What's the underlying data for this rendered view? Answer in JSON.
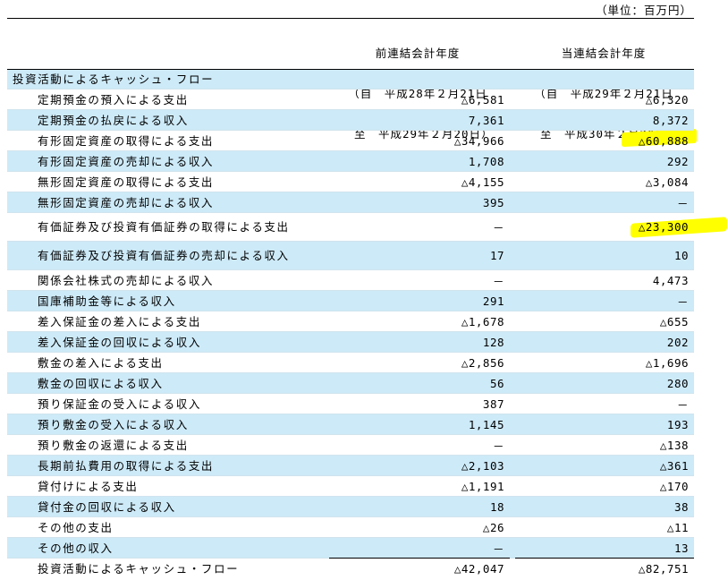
{
  "unit_label": "（単位：百万円）",
  "header": {
    "prev": [
      "前連結会計年度",
      "（自　平成28年２月21日",
      "　至　平成29年２月20日）"
    ],
    "curr": [
      "当連結会計年度",
      "（自　平成29年２月21日",
      "　至　平成30年２月20日）"
    ]
  },
  "section_title": "投資活動によるキャッシュ・フロー",
  "rows": [
    {
      "label": "定期預金の預入による支出",
      "prev": "△6,581",
      "curr": "△6,320"
    },
    {
      "label": "定期預金の払戻による収入",
      "prev": "7,361",
      "curr": "8,372"
    },
    {
      "label": "有形固定資産の取得による支出",
      "prev": "△34,966",
      "curr": "△60,888"
    },
    {
      "label": "有形固定資産の売却による収入",
      "prev": "1,708",
      "curr": "292"
    },
    {
      "label": "無形固定資産の取得による支出",
      "prev": "△4,155",
      "curr": "△3,084"
    },
    {
      "label": "無形固定資産の売却による収入",
      "prev": "395",
      "curr": "－"
    },
    {
      "label": "有価証券及び投資有価証券の取得による支出",
      "prev": "－",
      "curr": "△23,300"
    },
    {
      "label": "有価証券及び投資有価証券の売却による収入",
      "prev": "17",
      "curr": "10"
    },
    {
      "label": "関係会社株式の売却による収入",
      "prev": "－",
      "curr": "4,473"
    },
    {
      "label": "国庫補助金等による収入",
      "prev": "291",
      "curr": "－"
    },
    {
      "label": "差入保証金の差入による支出",
      "prev": "△1,678",
      "curr": "△655"
    },
    {
      "label": "差入保証金の回収による収入",
      "prev": "128",
      "curr": "202"
    },
    {
      "label": "敷金の差入による支出",
      "prev": "△2,856",
      "curr": "△1,696"
    },
    {
      "label": "敷金の回収による収入",
      "prev": "56",
      "curr": "280"
    },
    {
      "label": "預り保証金の受入による収入",
      "prev": "387",
      "curr": "－"
    },
    {
      "label": "預り敷金の受入による収入",
      "prev": "1,145",
      "curr": "193"
    },
    {
      "label": "預り敷金の返還による支出",
      "prev": "－",
      "curr": "△138"
    },
    {
      "label": "長期前払費用の取得による支出",
      "prev": "△2,103",
      "curr": "△361"
    },
    {
      "label": "貸付けによる支出",
      "prev": "△1,191",
      "curr": "△170"
    },
    {
      "label": "貸付金の回収による収入",
      "prev": "18",
      "curr": "38"
    },
    {
      "label": "その他の支出",
      "prev": "△26",
      "curr": "△11"
    },
    {
      "label": "その他の収入",
      "prev": "－",
      "curr": "13"
    }
  ],
  "total": {
    "label": "投資活動によるキャッシュ・フロー",
    "prev": "△42,047",
    "curr": "△82,751"
  },
  "highlight_color": "#ffff00",
  "shade_color": "#cdeaf8"
}
